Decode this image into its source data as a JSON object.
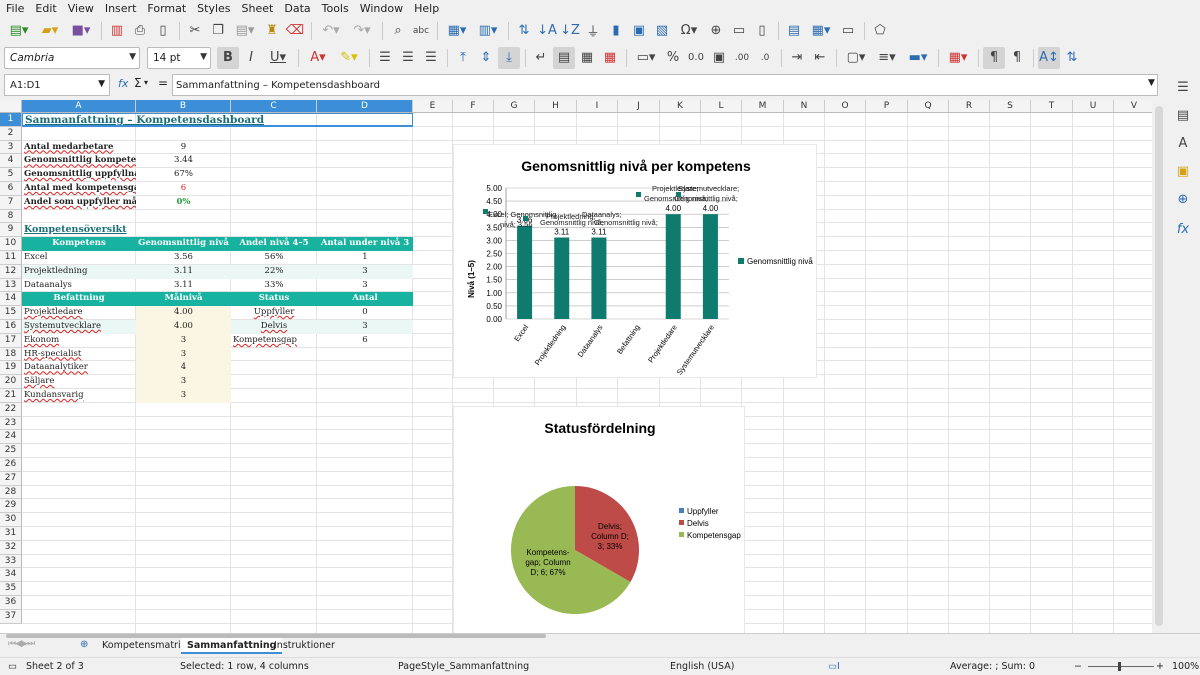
{
  "menu": [
    "File",
    "Edit",
    "View",
    "Insert",
    "Format",
    "Styles",
    "Sheet",
    "Data",
    "Tools",
    "Window",
    "Help"
  ],
  "toolbar": {
    "font_name": "Cambria",
    "font_size": "14 pt"
  },
  "formula_bar": {
    "name_box": "A1:D1",
    "fx": "fx",
    "sigma": "Σ",
    "equals": "=",
    "content": "Sammanfattning – Kompetensdashboard"
  },
  "columns": [
    "A",
    "B",
    "C",
    "D",
    "E",
    "F",
    "G",
    "H",
    "I",
    "J",
    "K",
    "L",
    "M",
    "N",
    "O",
    "P",
    "Q",
    "R",
    "S",
    "T",
    "U",
    "V"
  ],
  "rows": [
    "1",
    "2",
    "3",
    "4",
    "5",
    "6",
    "7",
    "8",
    "9",
    "10",
    "11",
    "12",
    "13",
    "14",
    "15",
    "16",
    "17",
    "18",
    "19",
    "20",
    "21",
    "22",
    "23",
    "24",
    "25",
    "26",
    "27",
    "28",
    "29",
    "30",
    "31",
    "32",
    "33",
    "34",
    "35",
    "36",
    "37"
  ],
  "sheet": {
    "title": "Sammanfattning – Kompetensdashboard",
    "stats": [
      {
        "label": "Antal medarbetare",
        "value": "9"
      },
      {
        "label": "Genomsnittlig kompeter",
        "value": "3.44"
      },
      {
        "label": "Genomsnittlig uppfyllnal",
        "value": "67%"
      },
      {
        "label": "Antal med kompetensgal",
        "value": "6"
      },
      {
        "label": "Andel som uppfyller mål",
        "value": "0%"
      }
    ],
    "section_title": "Kompetensöversikt",
    "table1_headers": [
      "Kompetens",
      "Genomsnittlig nivå",
      "Andel nivå 4–5",
      "Antal under nivå 3"
    ],
    "table1_rows": [
      [
        "Excel",
        "3.56",
        "56%",
        "1"
      ],
      [
        "Projektledning",
        "3.11",
        "22%",
        "3"
      ],
      [
        "Dataanalys",
        "3.11",
        "33%",
        "3"
      ]
    ],
    "table2_headers": [
      "Befattning",
      "Målnivå",
      "Status",
      "Antal"
    ],
    "table2_rows": [
      [
        "Projektledare",
        "4.00",
        "Uppfyller",
        "0"
      ],
      [
        "Systemutvecklare",
        "4.00",
        "Delvis",
        "3"
      ],
      [
        "Ekonom",
        "3",
        "Kompetensgap",
        "6"
      ],
      [
        "HR-specialist",
        "3",
        "",
        ""
      ],
      [
        "Dataanalytiker",
        "4",
        "",
        ""
      ],
      [
        "Säljare",
        "3",
        "",
        ""
      ],
      [
        "Kundansvarig",
        "3",
        "",
        ""
      ]
    ]
  },
  "chart_data": [
    {
      "type": "bar",
      "title": "Genomsnittlig nivå per kompetens",
      "ylabel": "Nivå (1–5)",
      "categories": [
        "Excel",
        "Projektledning",
        "Dataanalys",
        "Befattning",
        "Projektledare",
        "Systemutvecklare"
      ],
      "series": [
        {
          "name": "Genomsnittlig nivå",
          "values": [
            3.56,
            3.11,
            3.11,
            0,
            4.0,
            4.0
          ]
        }
      ],
      "value_labels": [
        "3.56",
        "3.11",
        "3.11",
        "",
        "4.00",
        "4.00"
      ],
      "ticks": [
        "0.00",
        "0.50",
        "1.00",
        "1.50",
        "2.00",
        "2.50",
        "3.00",
        "3.50",
        "4.00",
        "4.50",
        "5.00"
      ],
      "ylim": [
        0,
        5
      ],
      "color": "#0f7a6e",
      "legend": "right",
      "annotations": [
        "Excel; Genomsnittlig nivå; 3.56",
        "Projektledning; Genomsnittlig nivå;",
        "Dataanalys; Genomsnittlig nivå;",
        "Projektledare; Genomsnittlig nivå;",
        "Systemutvecklare; Genomsnittlig nivå;"
      ]
    },
    {
      "type": "pie",
      "title": "Statusfördelning",
      "labels": [
        "Uppfyller",
        "Delvis",
        "Kompetensgap"
      ],
      "values": [
        0,
        3,
        6
      ],
      "colors": [
        "#4a7ebb",
        "#be4b48",
        "#98b954"
      ],
      "slice_labels": [
        "",
        "Delvis; Column D; 3; 33%",
        "Kompetens-gap; Column D; 6; 67%"
      ],
      "legend": "right"
    }
  ],
  "tabs": [
    "Kompetensmatris",
    "Sammanfattning",
    "Instruktioner"
  ],
  "status": {
    "sheet": "Sheet 2 of 3",
    "selected": "Selected: 1 row, 4 columns",
    "pagestyle": "PageStyle_Sammanfattning",
    "lang": "English (USA)",
    "sum": "Average: ; Sum: 0",
    "zoom": "100%"
  }
}
